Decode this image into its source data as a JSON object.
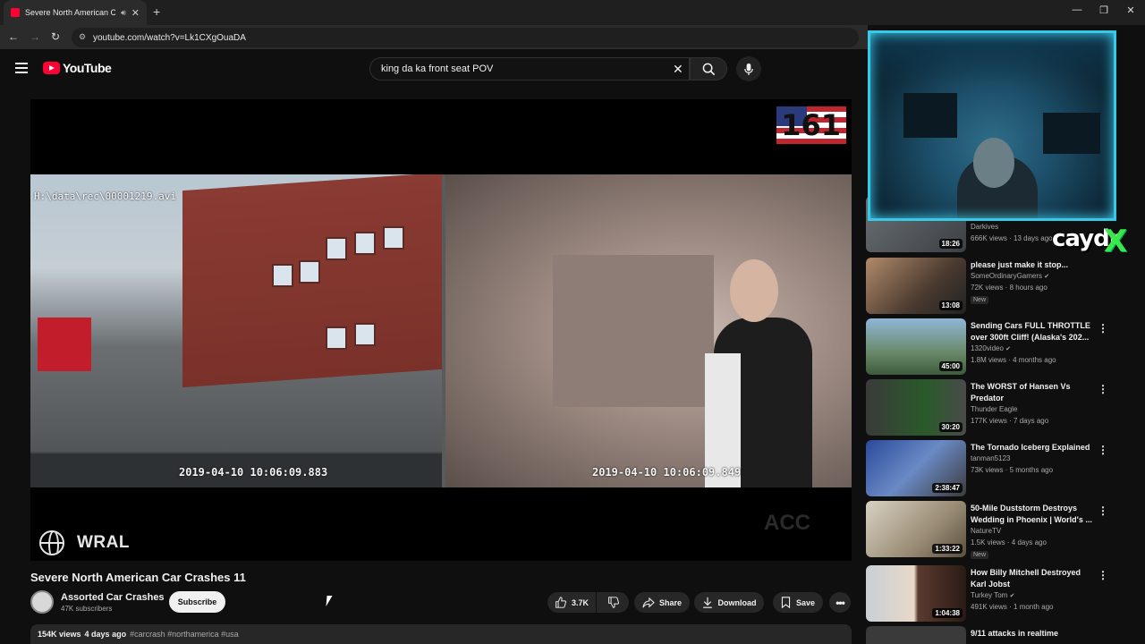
{
  "browser": {
    "tab_title": "Severe North American Car",
    "tab_close": "✕",
    "new_tab": "+",
    "url": "youtube.com/watch?v=Lk1CXgOuaDA"
  },
  "header": {
    "logo_text": "YouTube",
    "search_value": "king da ka front seat  POV",
    "clear_icon": "✕"
  },
  "player": {
    "counter": "161",
    "path_overlay": "H:\\data\\rec\\00001219.avi",
    "left_timestamp": "2019-04-10 10:06:09.883",
    "right_timestamp": "2019-04-10 10:06:09.849",
    "station": "WRAL",
    "watermark": "ACC"
  },
  "video": {
    "title": "Severe North American Car Crashes 11",
    "channel": "Assorted Car Crashes",
    "subscribers": "47K subscribers",
    "subscribe_label": "Subscribe",
    "likes": "3.7K",
    "share_label": "Share",
    "download_label": "Download",
    "save_label": "Save",
    "views": "154K views",
    "age": "4 days ago",
    "tags": "#carcrash #northamerica #usa"
  },
  "overlay": {
    "streamer": "caydr",
    "streamer_mark": "X"
  },
  "recommendations": [
    {
      "title": "",
      "channel": "Darkives",
      "meta": "666K views · 13 days ago",
      "duration": "18:26",
      "new": ""
    },
    {
      "title": "please just make it stop...",
      "channel": "SomeOrdinaryGamers",
      "meta": "72K views · 8 hours ago",
      "duration": "13:08",
      "new": "New"
    },
    {
      "title": "Sending Cars FULL THROTTLE over 300ft Cliff! (Alaska's 202...",
      "channel": "1320video",
      "meta": "1.8M views · 4 months ago",
      "duration": "45:00",
      "new": ""
    },
    {
      "title": "The WORST of Hansen Vs Predator",
      "channel": "Thunder Eagle",
      "meta": "177K views · 7 days ago",
      "duration": "30:20",
      "new": ""
    },
    {
      "title": "The Tornado Iceberg Explained",
      "channel": "tanman5123",
      "meta": "73K views · 5 months ago",
      "duration": "2:38:47",
      "new": ""
    },
    {
      "title": "50-Mile Duststorm Destroys Wedding in Phoenix | World's ...",
      "channel": "NatureTV",
      "meta": "1.5K views · 4 days ago",
      "duration": "1:33:22",
      "new": "New"
    },
    {
      "title": "How Billy Mitchell Destroyed Karl Jobst",
      "channel": "Turkey Tom",
      "meta": "491K views · 1 month ago",
      "duration": "1:04:38",
      "new": ""
    },
    {
      "title": "9/11 attacks in realtime",
      "channel": "",
      "meta": "",
      "duration": "",
      "new": ""
    }
  ]
}
